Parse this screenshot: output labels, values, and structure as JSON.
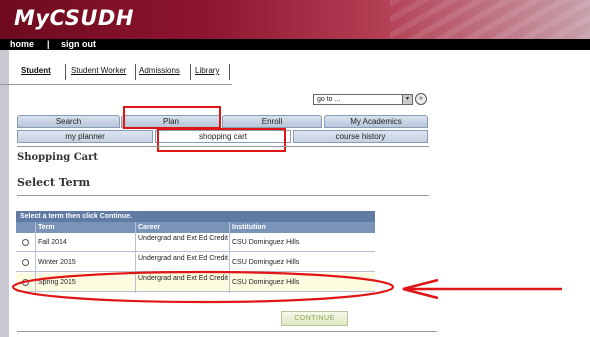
{
  "header": {
    "logo": "MyCSUDH"
  },
  "navbar": {
    "home": "home",
    "sep": "|",
    "signout": "sign out"
  },
  "top_tabs": [
    "Student",
    "Student Worker",
    "Admissions",
    "Library"
  ],
  "goto": {
    "value": "go to ...",
    "arrow": "▾",
    "go": "»"
  },
  "main_tabs": [
    "Search",
    "Plan",
    "Enroll",
    "My Academics"
  ],
  "sub_tabs": [
    "my planner",
    "shopping cart",
    "course history"
  ],
  "headings": {
    "cart": "Shopping Cart",
    "select": "Select Term"
  },
  "table": {
    "caption": "Select a term then click Continue.",
    "columns": [
      "Term",
      "Career",
      "Institution"
    ],
    "rows": [
      {
        "term": "Fall 2014",
        "career": "Undergrad and Ext Ed Credit",
        "institution": "CSU Dominguez Hills"
      },
      {
        "term": "Winter 2015",
        "career": "Undergrad and Ext Ed Credit",
        "institution": "CSU Dominguez Hills"
      },
      {
        "term": "Spring 2015",
        "career": "Undergrad and Ext Ed Credit",
        "institution": "CSU Dominguez Hills"
      }
    ]
  },
  "continue_label": "CONTINUE",
  "colors": {
    "annotation": "#e01515",
    "header_dark": "#6e0a1e",
    "table_header": "#7a93b9"
  }
}
